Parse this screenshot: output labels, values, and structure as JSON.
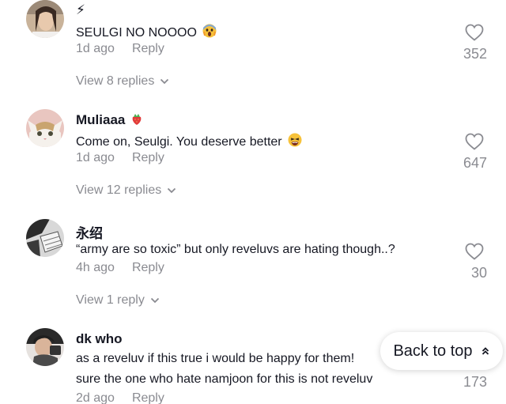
{
  "comments": [
    {
      "username": "⚡",
      "text": "SEULGI NO NOOOO",
      "text_emoji": "face-screaming-emoji",
      "time": "1d ago",
      "reply_label": "Reply",
      "likes": "352",
      "view_replies": "View 8 replies"
    },
    {
      "username": "Muliaaa",
      "username_emoji": "strawberry-emoji",
      "text": "Come on, Seulgi. You deserve better",
      "text_emoji": "tired-face-emoji",
      "time": "1d ago",
      "reply_label": "Reply",
      "likes": "647",
      "view_replies": "View 12 replies"
    },
    {
      "username": "永绍",
      "text": "“army are so toxic” but only reveluvs are hating though..?",
      "time": "4h ago",
      "reply_label": "Reply",
      "likes": "30",
      "view_replies": "View 1 reply"
    },
    {
      "username": "dk who",
      "text_line1": "as a reveluv if this true i would be happy for them!",
      "text_line2": "sure the one who hate namjoon for this is not reveluv",
      "time": "2d ago",
      "reply_label": "Reply",
      "likes": "173"
    }
  ],
  "back_to_top": {
    "label": "Back to top",
    "icon": "double-chevron-up-icon"
  },
  "colors": {
    "primary_text": "#161823",
    "secondary_text": "#8a8b91",
    "background": "#ffffff"
  }
}
